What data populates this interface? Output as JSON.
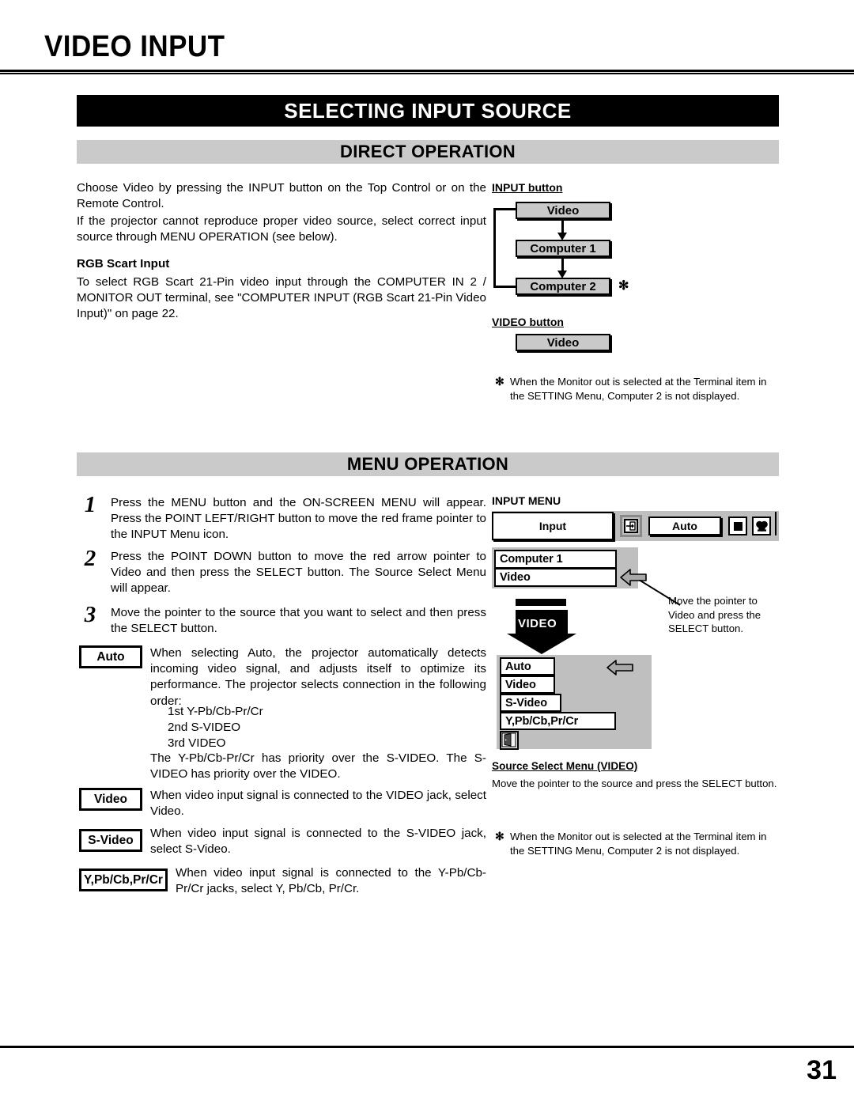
{
  "header": {
    "title": "VIDEO INPUT"
  },
  "sections": {
    "main_bar": "SELECTING INPUT SOURCE",
    "direct_bar": "DIRECT OPERATION",
    "menu_bar": "MENU OPERATION"
  },
  "direct_operation": {
    "intro_p1": "Choose Video by pressing the INPUT button on the Top Control or on the Remote Control.",
    "intro_p2": "If the projector cannot reproduce proper video source, select correct input source through MENU OPERATION (see below).",
    "rgb_heading": "RGB Scart Input",
    "rgb_body": "To select RGB Scart 21-Pin video input through the COMPUTER IN 2 / MONITOR OUT terminal, see \"COMPUTER INPUT (RGB Scart 21-Pin Video Input)\" on page 22."
  },
  "input_button_diagram": {
    "title": "INPUT button",
    "items": [
      "Video",
      "Computer 1",
      "Computer 2"
    ],
    "asterisk": "✻"
  },
  "video_button_diagram": {
    "title": "VIDEO button",
    "items": [
      "Video"
    ]
  },
  "footnote_top": {
    "mark": "✻",
    "text": "When the Monitor out is selected at the Terminal item in the SETTING Menu, Computer 2 is not displayed."
  },
  "menu_operation": {
    "steps": [
      {
        "num": "1",
        "text": "Press the MENU button and the ON-SCREEN MENU will appear.  Press the POINT LEFT/RIGHT button to move the red frame pointer to the INPUT Menu icon."
      },
      {
        "num": "2",
        "text": "Press the POINT DOWN button to move the red arrow pointer to Video and then press the SELECT button.  The Source Select Menu will appear."
      },
      {
        "num": "3",
        "text": "Move the pointer to the source that you want to select and then press the SELECT button."
      }
    ],
    "source_entries": [
      {
        "label": "Auto",
        "text": "When selecting Auto, the projector automatically detects incoming video signal, and adjusts itself to optimize its performance.  The projector selects connection in the following order:",
        "list": [
          "1st  Y-Pb/Cb-Pr/Cr",
          "2nd S-VIDEO",
          "3rd  VIDEO"
        ],
        "tail": "The Y-Pb/Cb-Pr/Cr has priority over the S-VIDEO.  The S-VIDEO has priority over the VIDEO."
      },
      {
        "label": "Video",
        "text": "When video input signal is connected to the VIDEO jack, select Video."
      },
      {
        "label": "S-Video",
        "text": "When video input signal is connected to the S-VIDEO jack, select S-Video."
      },
      {
        "label": "Y,Pb/Cb,Pr/Cr",
        "text": "When video input signal is connected to the Y-Pb/Cb-Pr/Cr jacks, select Y, Pb/Cb, Pr/Cr."
      }
    ]
  },
  "input_menu_osd": {
    "title": "INPUT MENU",
    "tab_label": "Input",
    "menu_icons": [
      "input-icon",
      "auto-icon",
      "screen-icon",
      "color-icon"
    ],
    "auto_label": "Auto",
    "list_items": [
      "Computer 1",
      "Video"
    ],
    "video_arrow_label": "VIDEO",
    "callout": "Move the pointer to Video and press the SELECT button."
  },
  "source_select_osd": {
    "items": [
      "Auto",
      "Video",
      "S-Video",
      "Y,Pb/Cb,Pr/Cr"
    ],
    "exit_icon": "exit-door-icon",
    "caption_title": "Source Select Menu (VIDEO)",
    "caption_body": "Move the pointer to the source and press the SELECT button."
  },
  "footnote_bottom": {
    "mark": "✻",
    "text": "When the Monitor out is selected at the Terminal item in the SETTING Menu, Computer 2 is not displayed."
  },
  "footer": {
    "page_number": "31"
  }
}
